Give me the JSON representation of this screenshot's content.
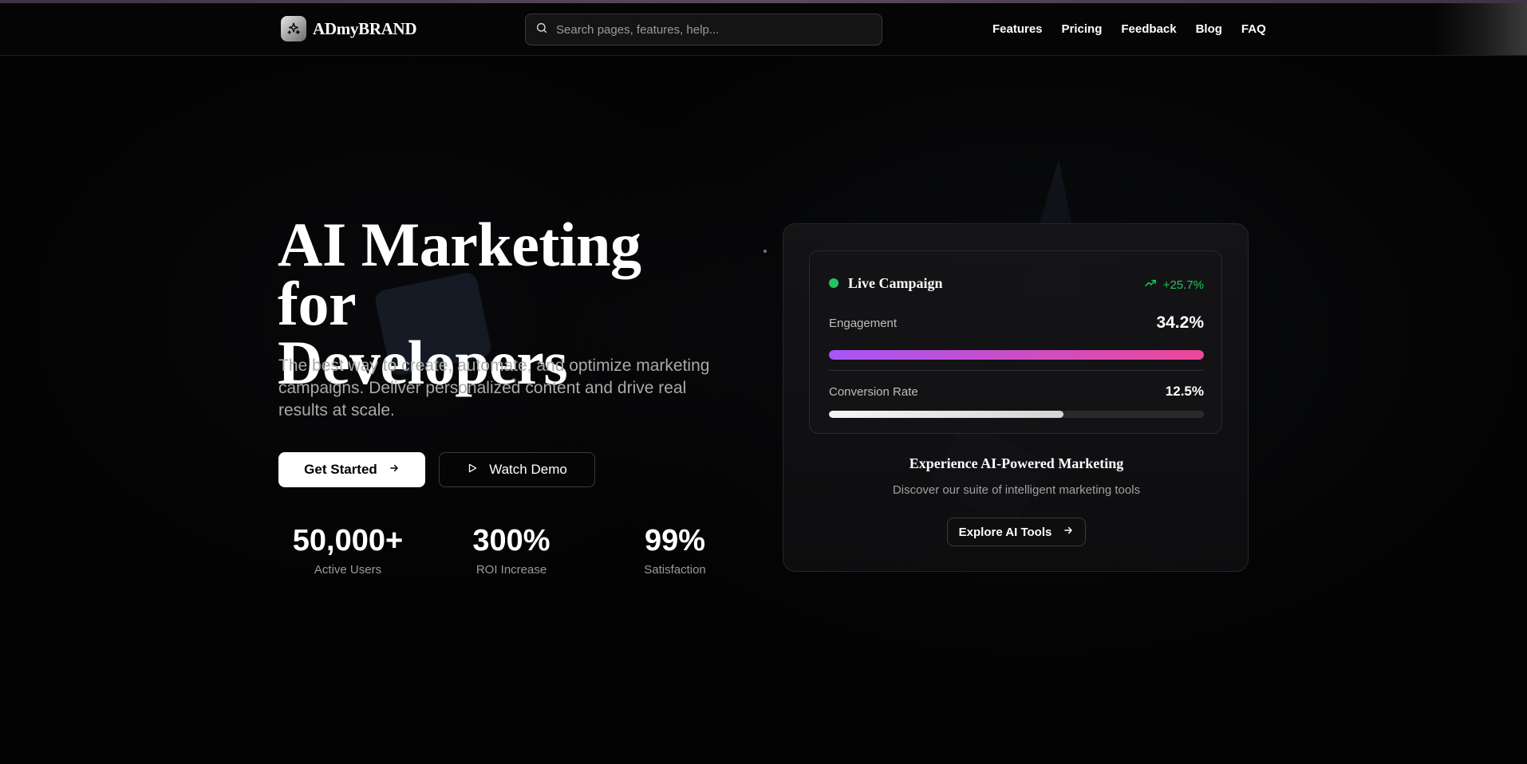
{
  "brand": {
    "name": "ADmyBRAND",
    "logo_icon": "sparkle-icon"
  },
  "search": {
    "placeholder": "Search pages, features, help...",
    "value": ""
  },
  "nav": {
    "items": [
      "Features",
      "Pricing",
      "Feedback",
      "Blog",
      "FAQ"
    ]
  },
  "hero": {
    "title_line1": "AI Marketing for",
    "title_line2": "Developers",
    "subtitle": "The best way to create, automate, and optimize marketing campaigns. Deliver personalized content and drive real results at scale.",
    "primary_cta": "Get Started",
    "secondary_cta": "Watch Demo"
  },
  "stats": [
    {
      "value": "50,000+",
      "label": "Active Users"
    },
    {
      "value": "300%",
      "label": "ROI Increase"
    },
    {
      "value": "99%",
      "label": "Satisfaction"
    }
  ],
  "campaign_card": {
    "status_label": "Live Campaign",
    "trend": "+25.7%",
    "metrics": [
      {
        "name": "Engagement",
        "value": "34.2%",
        "fill_fraction": 1.0
      },
      {
        "name": "Conversion Rate",
        "value": "12.5%",
        "fill_fraction": 0.625
      }
    ],
    "cta_title": "Experience AI-Powered Marketing",
    "cta_subtitle": "Discover our suite of intelligent marketing tools",
    "cta_button": "Explore AI Tools"
  },
  "colors": {
    "accent_green": "#22c55e",
    "engagement_gradient_start": "#a855f7",
    "engagement_gradient_end": "#ec4899",
    "conversion_fill": "#e5e5e5",
    "background": "#030303"
  }
}
